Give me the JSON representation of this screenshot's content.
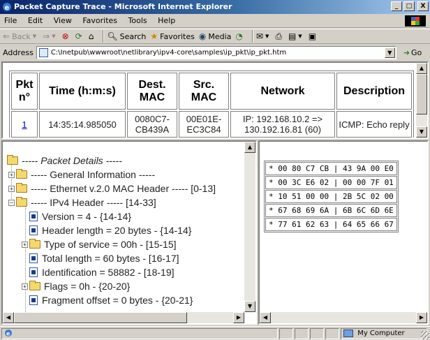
{
  "window": {
    "title": "Packet Capture Trace - Microsoft Internet Explorer",
    "minimize": "_",
    "maximize": "□",
    "close": "X"
  },
  "menu": [
    "File",
    "Edit",
    "View",
    "Favorites",
    "Tools",
    "Help"
  ],
  "toolbar": {
    "back": "Back",
    "forward": "",
    "stop": "",
    "refresh": "",
    "home": "",
    "search": "Search",
    "favorites": "Favorites",
    "media": "Media"
  },
  "address": {
    "label": "Address",
    "value": "C:\\Inetpub\\wwwroot\\netlibrary\\ipv4-core\\samples\\ip_pkt\\ip_pkt.htm",
    "go": "Go"
  },
  "packet_table": {
    "headers": [
      "Pkt n°",
      "Time (h:m:s)",
      "Dest. MAC",
      "Src. MAC",
      "Network",
      "Description"
    ],
    "row": [
      "1",
      "14:35:14.985050",
      "0080C7-CB439A",
      "00E01E-EC3C84",
      "IP: 192.168.10.2 => 130.192.16.81 (60)",
      "ICMP: Echo reply"
    ]
  },
  "tree": [
    {
      "label": "----- Packet Details -----",
      "italic": true
    },
    {
      "label": "----- General Information -----"
    },
    {
      "label": "----- Ethernet v.2.0 MAC Header ----- [0-13]"
    },
    {
      "label": "----- IPv4 Header ----- [14-33]"
    },
    {
      "label": "Version = 4 - {14-14}"
    },
    {
      "label": "Header length = 20 bytes - {14-14}"
    },
    {
      "label": "Type of service = 00h - [15-15]"
    },
    {
      "label": "Total length = 60 bytes - [16-17]"
    },
    {
      "label": "Identification = 58882 - [18-19]"
    },
    {
      "label": "Flags = 0h - {20-20}"
    },
    {
      "label": "Fragment offset = 0 bytes - {20-21}"
    }
  ],
  "hex_rows": [
    "* 00 80 C7 CB | 43 9A 00 E0",
    "* 00 3C E6 02 | 00 00 7F 01",
    "* 10 51 00 00 | 2B 5C 02 00",
    "* 67 68 69 6A | 6B 6C 6D 6E",
    "* 77 61 62 63 | 64 65 66 67"
  ],
  "status": {
    "zone": "My Computer"
  }
}
